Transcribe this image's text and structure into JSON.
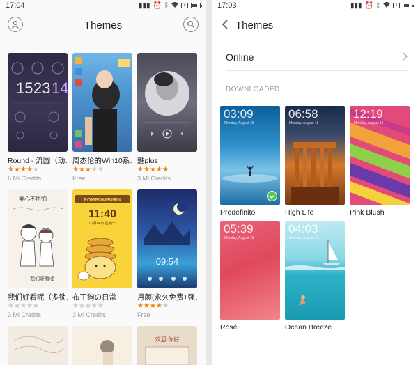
{
  "left_screen": {
    "status": {
      "time": "17:04"
    },
    "header": {
      "title": "Themes",
      "profile_icon": "profile-icon",
      "search_icon": "search-icon"
    },
    "themes": [
      {
        "name": "Round - 流圆（动…",
        "rating": 4,
        "price": "6 Mi Credits"
      },
      {
        "name": "周杰伦的Win10系…",
        "rating": 2.5,
        "price": "Free"
      },
      {
        "name": "魅plus",
        "rating": 4.5,
        "price": "3 Mi Credits"
      },
      {
        "name": "我们好看呢（多锁…",
        "rating": 0,
        "price": "3 Mi Credits"
      },
      {
        "name": "布丁狗の日常",
        "rating": 0,
        "price": "3 Mi Credits"
      },
      {
        "name": "月颜(永久免费+强…",
        "rating": 4,
        "price": "Free"
      }
    ],
    "thumb_text": {
      "round_time": "15 23 14",
      "round_h": "15",
      "round_m": "23",
      "round_s": "14",
      "pompom_brand": "POMPOMPURIN",
      "pompom_time": "11:40",
      "pompom_date": "01月04日 星期一",
      "moon_time": "09:54",
      "note_title": "爱心不用怕",
      "note_line": "我们好看呢",
      "cal_title": "欢迎·你好"
    }
  },
  "right_screen": {
    "status": {
      "time": "17:03"
    },
    "header": {
      "title": "Themes",
      "back_icon": "back-arrow-icon"
    },
    "online": {
      "label": "Online",
      "chevron_icon": "chevron-right-icon"
    },
    "section_label": "DOWNLOADED",
    "downloaded": [
      {
        "name": "Predefinito",
        "time": "03:09",
        "date": "Monday, August 15",
        "selected": true
      },
      {
        "name": "High Life",
        "time": "06:58",
        "date": "Monday, August 15",
        "selected": false
      },
      {
        "name": "Pink Blush",
        "time": "12:19",
        "date": "Monday, August 15",
        "selected": false
      },
      {
        "name": "Rosé",
        "time": "05:39",
        "date": "Monday, August 15",
        "selected": false
      },
      {
        "name": "Ocean Breeze",
        "time": "04:03",
        "date": "Monday, August 15",
        "selected": false
      }
    ]
  },
  "colors": {
    "accent_star": "#f57c00",
    "selected_check": "#5ac45a"
  }
}
